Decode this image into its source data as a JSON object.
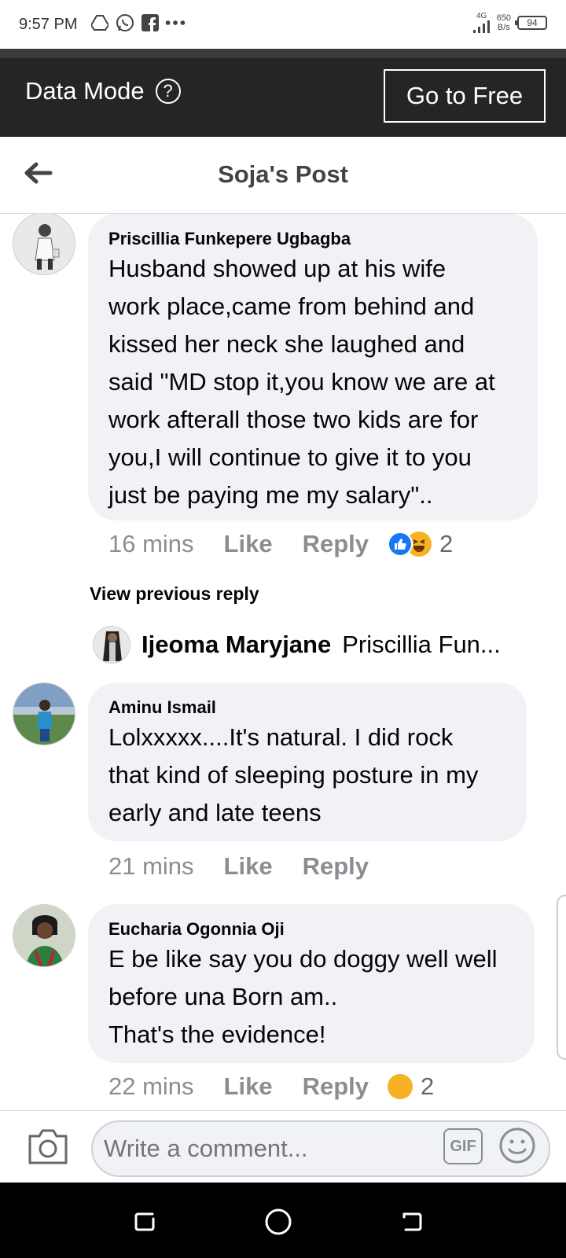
{
  "status_bar": {
    "time": "9:57 PM",
    "signal": "4G",
    "net_speed_value": "650",
    "net_speed_unit": "B/s",
    "battery": "94",
    "icons": [
      "drive-icon",
      "whatsapp-icon",
      "facebook-icon",
      "more-dots-icon"
    ]
  },
  "data_mode": {
    "label": "Data Mode",
    "help": "?",
    "button": "Go to Free"
  },
  "header": {
    "title": "Soja's Post"
  },
  "comments": [
    {
      "author": "Priscillia Funkepere Ugbagba",
      "text": "Husband showed up at his wife\nwork place,came from behind and\nkissed her neck she laughed and\nsaid \"MD stop it,you know we are at\nwork afterall those two kids are for\nyou,I will continue to give it to you\njust be paying me my salary\"..",
      "time": "16 mins",
      "like": "Like",
      "reply": "Reply",
      "reaction_count": "2"
    },
    {
      "author": "Aminu Ismail",
      "text": "Lolxxxxx....It's natural. I did rock\nthat kind of sleeping posture in my\nearly and late teens",
      "time": "21 mins",
      "like": "Like",
      "reply": "Reply"
    },
    {
      "author": "Eucharia Ogonnia Oji",
      "text": "E be like say you do doggy well well\nbefore una Born am..\nThat's the evidence!",
      "time": "22 mins",
      "like": "Like",
      "reply": "Reply",
      "reaction_count": "2"
    }
  ],
  "view_previous": "View previous reply",
  "reply_preview": {
    "name": "Ijeoma Maryjane",
    "snippet": "Priscillia Fun..."
  },
  "composer": {
    "placeholder": "Write a comment...",
    "gif": "GIF"
  }
}
